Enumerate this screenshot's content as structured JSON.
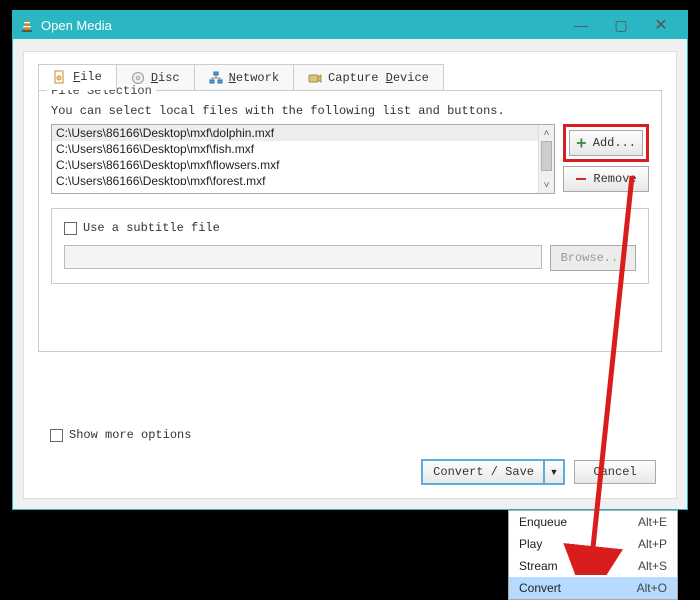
{
  "window": {
    "title": "Open Media"
  },
  "tabs": [
    {
      "label_prefix": "",
      "underline": "F",
      "label_suffix": "ile"
    },
    {
      "label_prefix": "",
      "underline": "D",
      "label_suffix": "isc"
    },
    {
      "label_prefix": "",
      "underline": "N",
      "label_suffix": "etwork"
    },
    {
      "label_prefix": "Capture ",
      "underline": "D",
      "label_suffix": "evice"
    }
  ],
  "file_selection": {
    "group_label": "File Selection",
    "hint": "You can select local files with the following list and buttons.",
    "files": [
      "C:\\Users\\86166\\Desktop\\mxf\\dolphin.mxf",
      "C:\\Users\\86166\\Desktop\\mxf\\fish.mxf",
      "C:\\Users\\86166\\Desktop\\mxf\\flowsers.mxf",
      "C:\\Users\\86166\\Desktop\\mxf\\forest.mxf"
    ],
    "add_label": "Add...",
    "remove_label": "Remove"
  },
  "subtitle": {
    "checkbox_label": "Use a subtitle file",
    "browse_label": "Browse..."
  },
  "more_options_label": "Show more options",
  "convert_save_label": "Convert / Save",
  "cancel_label": "Cancel",
  "menu": {
    "items": [
      {
        "label": "Enqueue",
        "key": "Alt+E"
      },
      {
        "label": "Play",
        "key": "Alt+P"
      },
      {
        "label": "Stream",
        "key": "Alt+S"
      },
      {
        "label": "Convert",
        "key": "Alt+O"
      }
    ]
  }
}
